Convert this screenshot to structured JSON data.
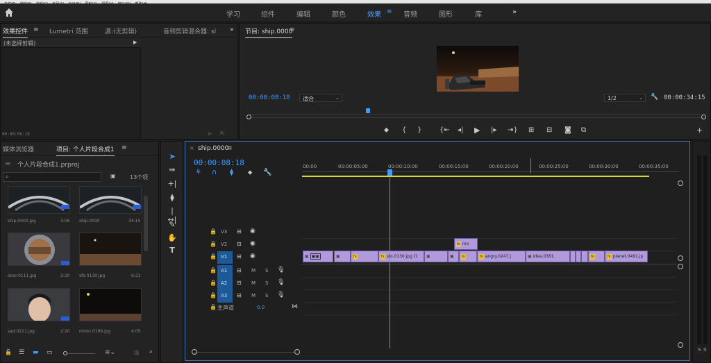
{
  "menubar": [
    "文件(F)",
    "编辑(E)",
    "剪辑(C)",
    "序列(S)",
    "标记(M)",
    "图形(G)",
    "视图(V)",
    "窗口(W)",
    "帮助(H)"
  ],
  "workspaces": {
    "tabs": [
      "学习",
      "组件",
      "编辑",
      "颜色",
      "效果",
      "音频",
      "图形",
      "库"
    ],
    "active": "效果",
    "more": "»"
  },
  "effects_panel": {
    "tabs": [
      "效果控件",
      "Lumetri 范围",
      "源:(无剪辑)",
      "音频剪辑混合器: sl"
    ],
    "more": "»",
    "no_clip": "(未选择剪辑)",
    "timecode": "00:00:08:18"
  },
  "program_monitor": {
    "tab": "节目: ship.0000",
    "timecode": "00:00:08:18",
    "fit": "适合",
    "resolution": "1/2",
    "duration": "00:00:34:15"
  },
  "project_panel": {
    "tabs": [
      "媒体浏览器",
      "项目: 个人片段合成1"
    ],
    "file": "个人片段合成1.prproj",
    "search_placeholder": "",
    "count": "13个项",
    "items": [
      {
        "name": "ship.0000.jpg",
        "duration": "3:06"
      },
      {
        "name": "ship.0000",
        "duration": "34:15"
      },
      {
        "name": "door.0111.jpg",
        "duration": "2:20"
      },
      {
        "name": "sfo.0130.jpg",
        "duration": "6:21"
      },
      {
        "name": "sad.0211.jpg",
        "duration": "2:20"
      },
      {
        "name": "moon.0196.jpg",
        "duration": "4:05"
      }
    ]
  },
  "timeline": {
    "tab": "ship.0000",
    "timecode": "00:00:08:18",
    "ruler": [
      "00:00",
      "00:00:05:00",
      "00:00:10:00",
      "00:00:15:00",
      "00:00:20:00",
      "00:00:25:00",
      "00:00:30:00",
      "00:00:35:00"
    ],
    "tracks": {
      "v3": "V3",
      "v2": "V2",
      "v1": "V1",
      "a1": "A1",
      "a2": "A2",
      "a3": "A3",
      "master": "主声道",
      "master_value": "0.0",
      "mute": "M",
      "solo": "S"
    },
    "clips": {
      "v2": "mo",
      "v1": [
        "sfo.0130.jpg [1",
        "angry.0247.j",
        "idea.0361.",
        "planet.0491.jp"
      ]
    }
  },
  "right_meter": {
    "labels": [
      "S",
      "S"
    ]
  },
  "colors": {
    "accent": "#3f9cff",
    "clip": "#b09adb",
    "fx": "#e8c23c",
    "playhead": "#3f9cff"
  }
}
